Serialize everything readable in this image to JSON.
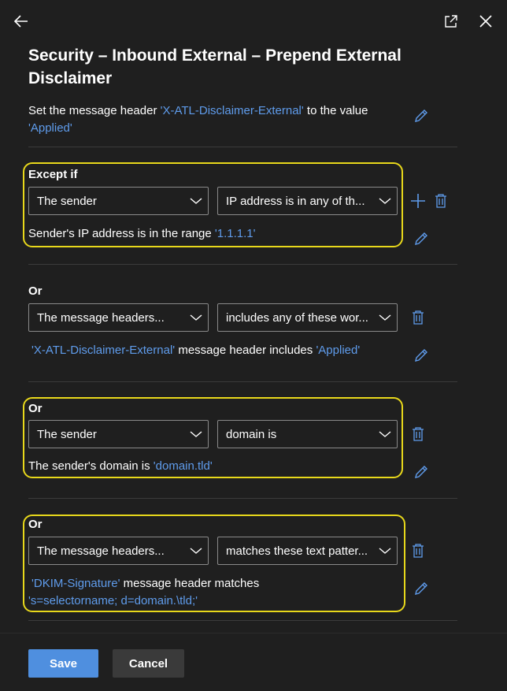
{
  "header": {
    "title": "Security – Inbound External – Prepend External Disclaimer"
  },
  "action": {
    "prefix": "Set the message header ",
    "header_name": "'X-ATL-Disclaimer-External'",
    "middle": " to the value ",
    "value": "'Applied'"
  },
  "conditions": [
    {
      "label": "Except if",
      "dropdown1": "The sender",
      "dropdown2": "IP address is in any of th...",
      "summary_prefix": "Sender's IP address is in the range ",
      "summary_value": "'1.1.1.1'"
    },
    {
      "label": "Or",
      "dropdown1": "The message headers...",
      "dropdown2": "includes any of these wor...",
      "summary_value1": "'X-ATL-Disclaimer-External'",
      "summary_middle": " message header includes ",
      "summary_value2": "'Applied'"
    },
    {
      "label": "Or",
      "dropdown1": "The sender",
      "dropdown2": "domain is",
      "summary_prefix": "The sender's domain is ",
      "summary_value": "'domain.tld'"
    },
    {
      "label": "Or",
      "dropdown1": "The message headers...",
      "dropdown2": "matches these text patter...",
      "summary_value1": "'DKIM-Signature'",
      "summary_middle": " message header matches",
      "summary_value2": "'s=selectorname; d=domain.\\tld;'"
    }
  ],
  "footer": {
    "save_label": "Save",
    "cancel_label": "Cancel"
  },
  "colors": {
    "accent": "#4f8fdf",
    "link": "#5f9cec",
    "highlight": "#e8d81b",
    "background": "#1f1f1f"
  },
  "icons": [
    "back-arrow-icon",
    "pop-out-icon",
    "close-icon",
    "edit-icon",
    "add-icon",
    "delete-icon",
    "chevron-down-icon"
  ]
}
